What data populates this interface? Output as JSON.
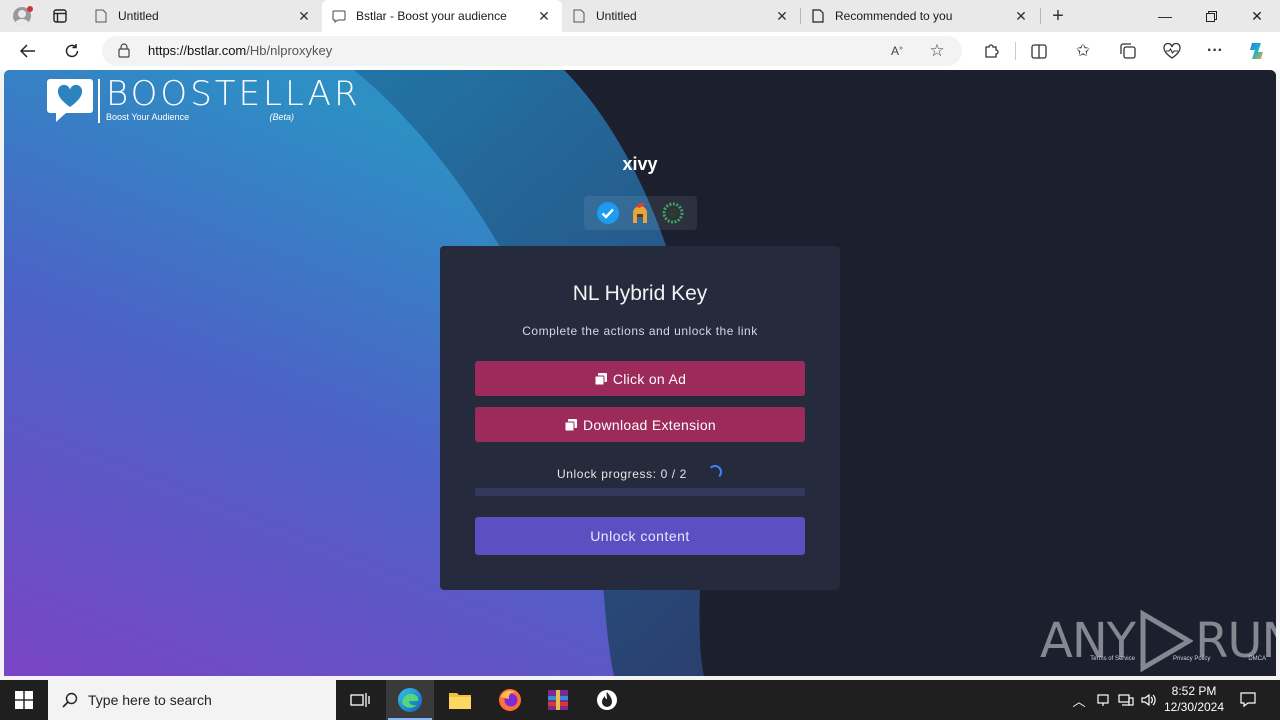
{
  "browser": {
    "tabs": [
      {
        "title": "Untitled",
        "active": false
      },
      {
        "title": "Bstlar - Boost your audience",
        "active": true
      },
      {
        "title": "Untitled",
        "active": false
      },
      {
        "title": "Recommended to you",
        "active": false
      }
    ],
    "url_host": "https://bstlar.com",
    "url_path": "/Hb/nlproxykey"
  },
  "page": {
    "logo": {
      "brand": "BOOSTELLAR",
      "tagline": "Boost Your Audience",
      "beta": "(Beta)"
    },
    "username": "xivy",
    "badges": [
      "verified-badge-icon",
      "spartan-helmet-badge-icon",
      "laurel-wreath-badge-icon"
    ],
    "card": {
      "title": "NL Hybrid Key",
      "subtitle": "Complete the actions and unlock the link",
      "actions": [
        {
          "label": "Click on Ad"
        },
        {
          "label": "Download Extension"
        }
      ],
      "progress_label": "Unlock progress: 0 / 2",
      "progress_fraction": 0,
      "unlock_label": "Unlock content"
    },
    "footer_links": [
      "Terms of Service",
      "Privacy Policy",
      "DMCA"
    ],
    "watermark": {
      "left": "ANY",
      "right": "RUN"
    }
  },
  "taskbar": {
    "search_placeholder": "Type here to search",
    "time": "8:52 PM",
    "date": "12/30/2024"
  },
  "colors": {
    "action_button": "#9c2a5a",
    "unlock_button": "#5b4fc2",
    "card_bg": "#262a3d",
    "page_dark": "#1c1f2e"
  }
}
